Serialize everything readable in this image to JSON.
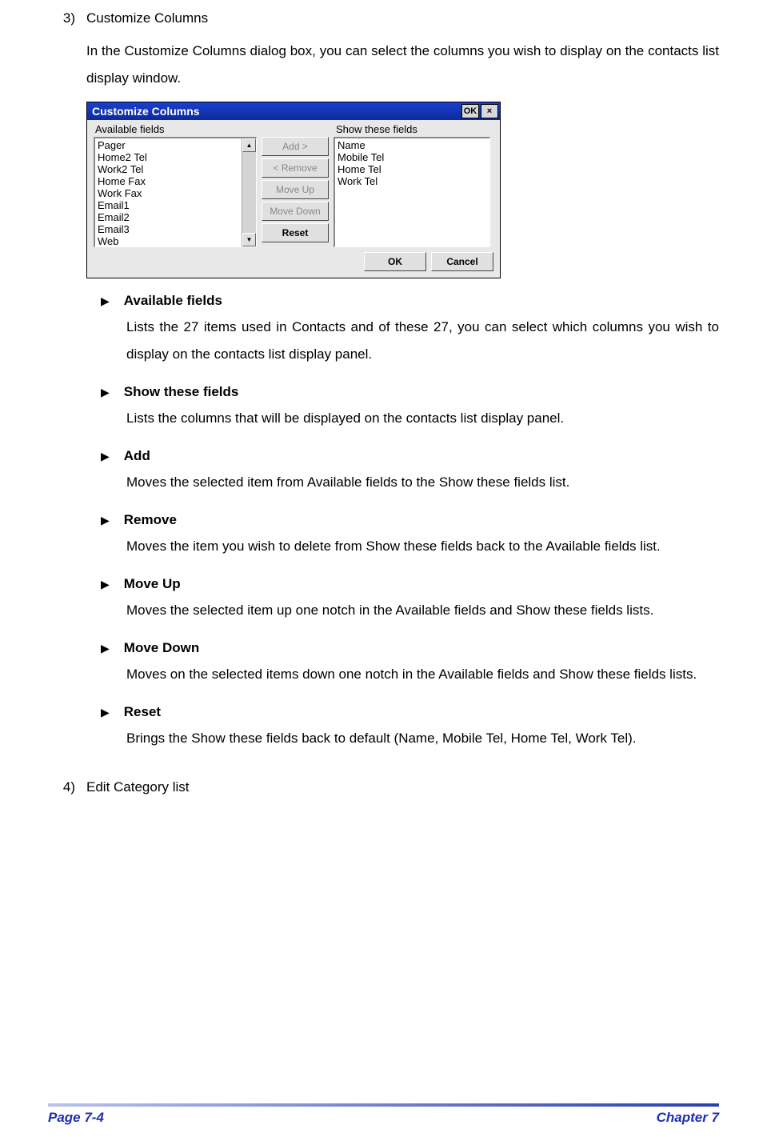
{
  "section3": {
    "number": "3)",
    "title": "Customize Columns",
    "intro": "In the Customize Columns dialog box, you can select the columns you wish to display on the contacts list display window."
  },
  "dialog": {
    "title": "Customize Columns",
    "titlebar_ok": "OK",
    "titlebar_close": "×",
    "available_label": "Available fields",
    "show_label": "Show these fields",
    "available_items": [
      "Pager",
      "Home2 Tel",
      "Work2 Tel",
      "Home Fax",
      "Work Fax",
      "Email1",
      "Email2",
      "Email3",
      "Web"
    ],
    "show_items": [
      "Name",
      "Mobile Tel",
      "Home Tel",
      "Work Tel"
    ],
    "buttons": {
      "add": "Add >",
      "remove": "< Remove",
      "move_up": "Move Up",
      "move_down": "Move Down",
      "reset": "Reset",
      "ok": "OK",
      "cancel": "Cancel"
    },
    "scroll_up": "▲",
    "scroll_down": "▼"
  },
  "bullets": [
    {
      "title": "Available fields",
      "body": "Lists the 27 items used in Contacts and of these 27, you can select which columns you wish to display on the contacts list display panel."
    },
    {
      "title": "Show these fields",
      "body": "Lists the columns that will be displayed on the contacts list display panel."
    },
    {
      "title": "Add",
      "body": "Moves the selected item from Available fields to the Show these fields list."
    },
    {
      "title": "Remove",
      "body": "Moves the item you wish to delete from Show these fields back to the Available fields list."
    },
    {
      "title": "Move Up",
      "body": "Moves the selected item up one notch in the Available fields and Show these fields lists."
    },
    {
      "title": "Move Down",
      "body": "Moves on the selected items down one notch in the Available fields and Show these fields lists."
    },
    {
      "title": "Reset",
      "body": "Brings the Show these fields back to default (Name, Mobile Tel, Home Tel, Work Tel)."
    }
  ],
  "bullet_glyph": "▶",
  "section4": {
    "number": "4)",
    "title": "Edit Category list"
  },
  "footer": {
    "left": "Page 7-4",
    "right": "Chapter 7"
  }
}
